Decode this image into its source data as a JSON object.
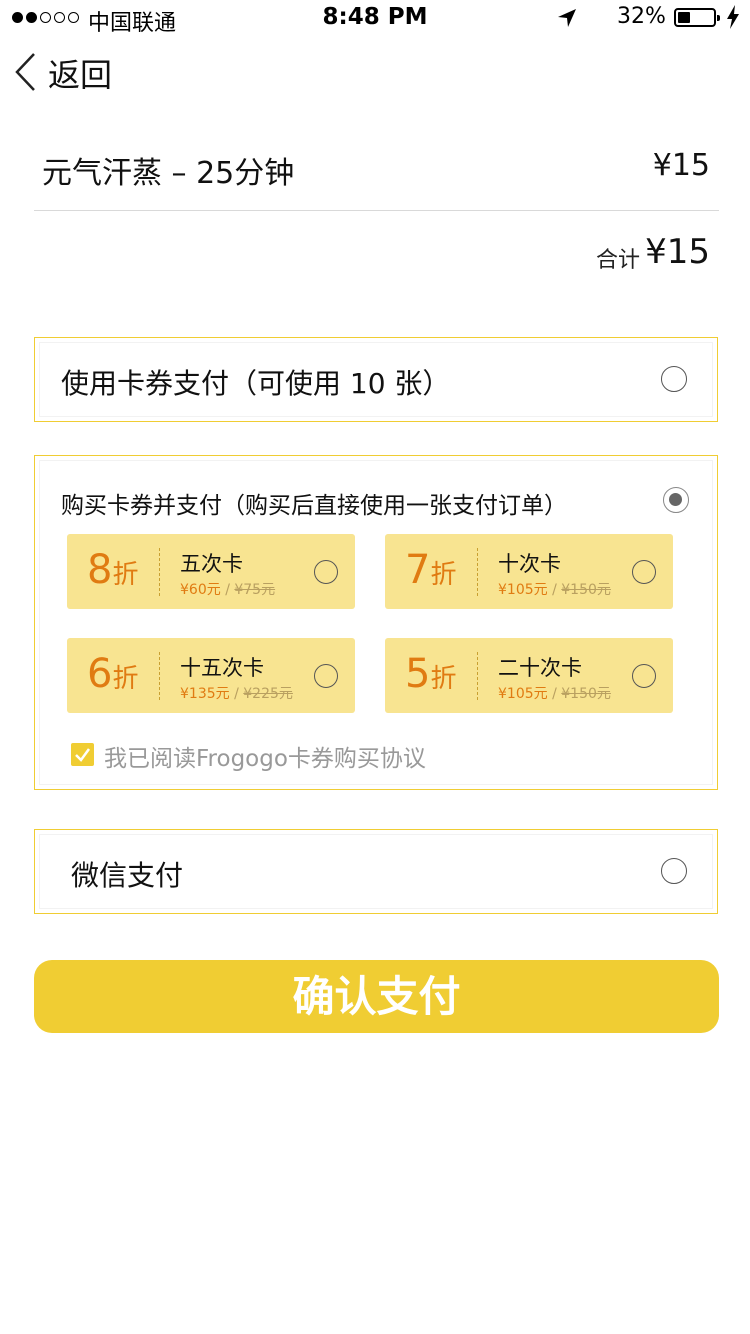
{
  "status_bar": {
    "carrier": "中国联通",
    "time": "8:48 PM",
    "battery": "32%",
    "battery_level": 0.32
  },
  "nav": {
    "back_label": "返回"
  },
  "order": {
    "item_name": "元气汗蒸 – 25分钟",
    "item_price": "¥15",
    "total_label": "合计",
    "total_value": "¥15"
  },
  "payment_options": {
    "coupon": {
      "label": "使用卡券支付（可使用 10 张）",
      "selected": false
    },
    "buy_card": {
      "label": "购买卡券并支付（购买后直接使用一张支付订单）",
      "selected": true,
      "cards": [
        {
          "discount": "8",
          "unit": "折",
          "name": "五次卡",
          "price": "¥60元",
          "sep": "/",
          "original": "¥75元"
        },
        {
          "discount": "7",
          "unit": "折",
          "name": "十次卡",
          "price": "¥105元",
          "sep": "/",
          "original": "¥150元"
        },
        {
          "discount": "6",
          "unit": "折",
          "name": "十五次卡",
          "price": "¥135元",
          "sep": "/",
          "original": "¥225元"
        },
        {
          "discount": "5",
          "unit": "折",
          "name": "二十次卡",
          "price": "¥105元",
          "sep": "/",
          "original": "¥150元"
        }
      ],
      "agreement": "我已阅读Frogogo卡券购买协议",
      "agreement_checked": true
    },
    "wechat": {
      "label": "微信支付",
      "selected": false
    }
  },
  "confirm_button": "确认支付",
  "colors": {
    "accent": "#f0cd33",
    "card_bg": "#f8e491",
    "discount_text": "#e07b12"
  }
}
